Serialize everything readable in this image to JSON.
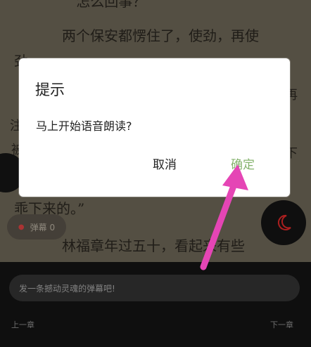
{
  "reader": {
    "top_fragment": "“怎么回事？”",
    "line_1": "两个保安都愣住了，使劲，再使",
    "line_2": "劲",
    "line_3": "乖下来的。”",
    "line_4": "林福章年过五十，看起来有些",
    "left_fragment_1": "注",
    "left_fragment_2": "被",
    "right_fragment_1": "再",
    "right_fragment_2": "下"
  },
  "bullet_button": {
    "label": "弹幕 0"
  },
  "comment_bar": {
    "placeholder": "发一条撼动灵魂的弹幕吧!",
    "previous": "上一章",
    "next": "下一章"
  },
  "dialog": {
    "title": "提示",
    "message": "马上开始语音朗读?",
    "cancel": "取消",
    "confirm": "确定"
  },
  "colors": {
    "accent": "#85b36e",
    "annotation": "#e545b5",
    "danmaku_dot": "#b93838"
  },
  "icons": {
    "night_mode": "moon-icon",
    "annotation": "arrow-icon"
  }
}
